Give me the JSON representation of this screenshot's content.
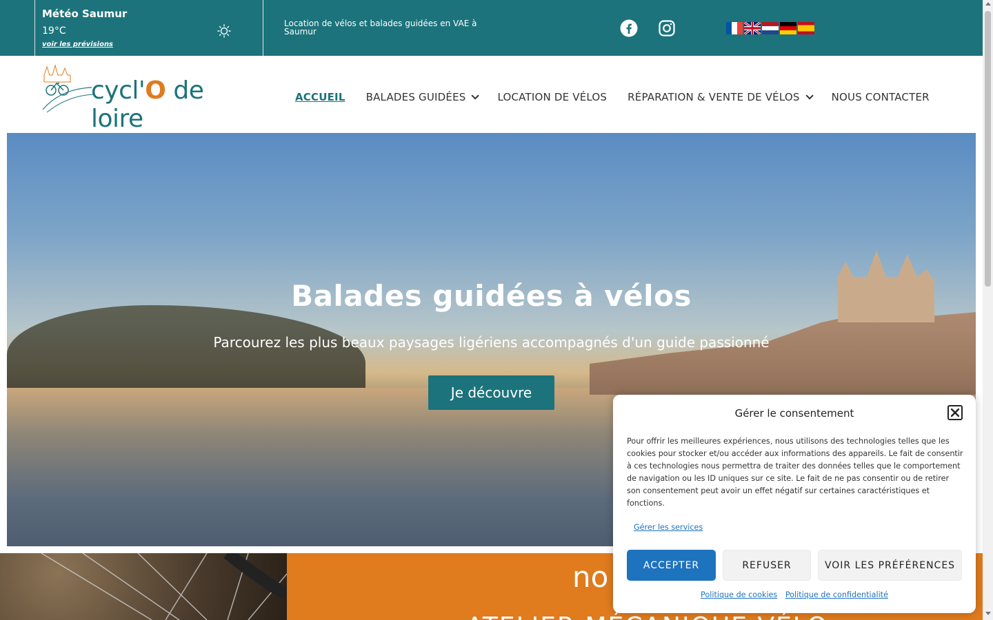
{
  "topbar": {
    "weather_title": "Météo Saumur",
    "weather_temp": "19°C",
    "weather_link": "voir les prévisions",
    "tagline": "Location de vélos et balades guidées en VAE à Saumur"
  },
  "flags": [
    "fr",
    "en",
    "nl",
    "de",
    "es"
  ],
  "logo": {
    "prefix": "cycl'",
    "o": "O",
    "suffix": " de loire"
  },
  "nav": {
    "items": [
      {
        "label": "ACCUEIL",
        "active": true,
        "dropdown": false
      },
      {
        "label": "BALADES GUIDÉES",
        "active": false,
        "dropdown": true
      },
      {
        "label": "LOCATION DE VÉLOS",
        "active": false,
        "dropdown": false
      },
      {
        "label": "RÉPARATION & VENTE DE VÉLOS",
        "active": false,
        "dropdown": true
      },
      {
        "label": "NOUS CONTACTER",
        "active": false,
        "dropdown": false
      }
    ]
  },
  "hero": {
    "title": "Balades guidées à vélos",
    "subtitle": "Parcourez les plus beaux paysages ligériens accompagnés d'un guide passionné",
    "button": "Je découvre"
  },
  "section": {
    "heading": "no",
    "subheading": "ATELIER MÉCANIQUE VÉLO"
  },
  "consent": {
    "title": "Gérer le consentement",
    "text": "Pour offrir les meilleures expériences, nous utilisons des technologies telles que les cookies pour stocker et/ou accéder aux informations des appareils. Le fait de consentir à ces technologies nous permettra de traiter des données telles que le comportement de navigation ou les ID uniques sur ce site. Le fait de ne pas consentir ou de retirer son consentement peut avoir un effet négatif sur certaines caractéristiques et fonctions.",
    "manage": "Gérer les services",
    "accept": "ACCEPTER",
    "refuse": "REFUSER",
    "prefs": "VOIR LES PRÉFÉRENCES",
    "cookie_policy": "Politique de cookies",
    "privacy_policy": "Politique de confidentialité"
  },
  "colors": {
    "teal": "#1c737b",
    "orange": "#e07b1e",
    "blue": "#1e73be"
  }
}
